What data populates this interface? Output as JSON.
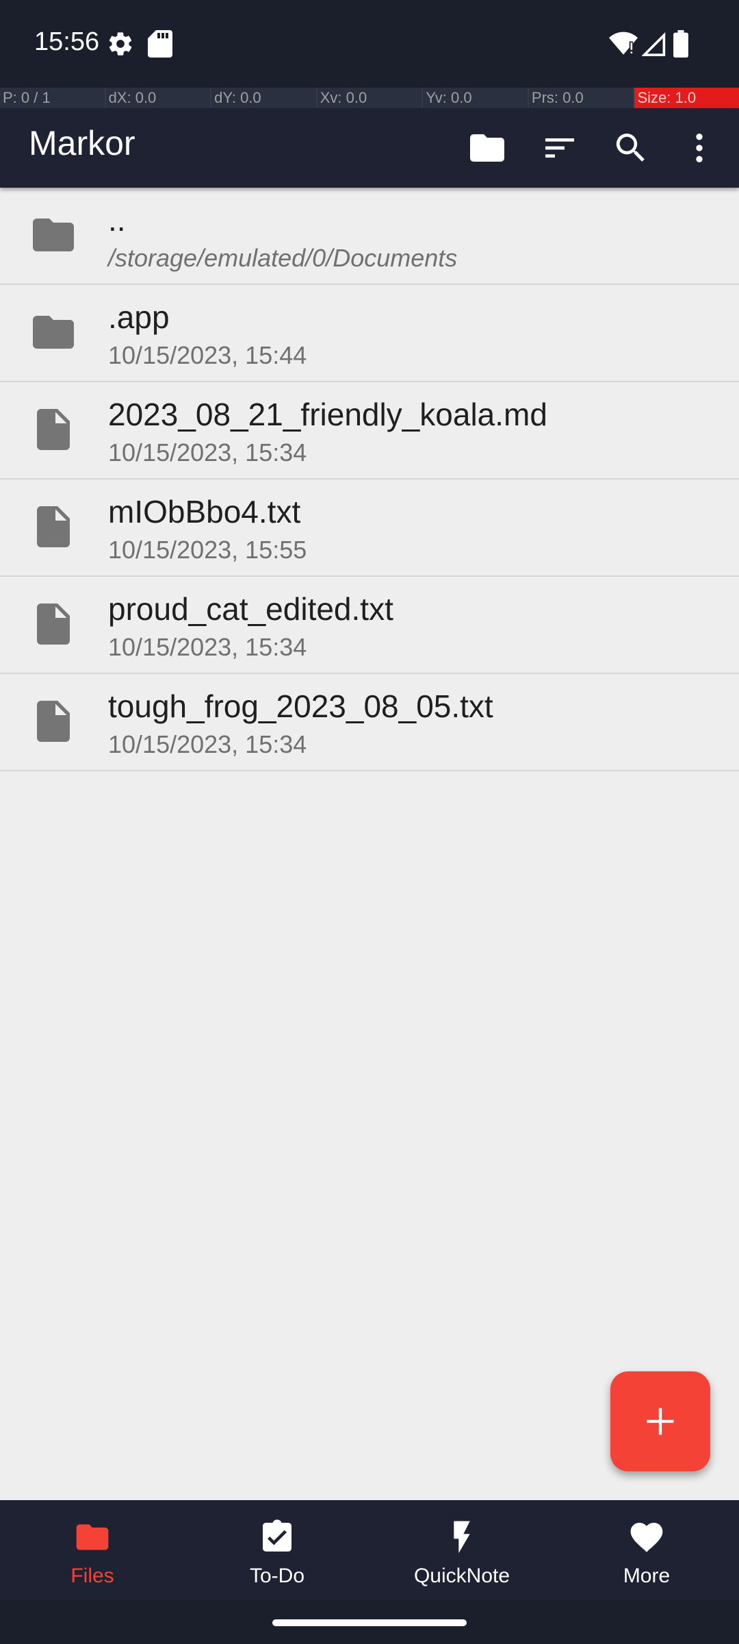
{
  "status_bar": {
    "time": "15:56",
    "icons": [
      "settings-icon",
      "sd-card-icon",
      "wifi-icon",
      "signal-icon",
      "battery-icon"
    ]
  },
  "debug_overlay": [
    "P: 0 / 1",
    "dX: 0.0",
    "dY: 0.0",
    "Xv: 0.0",
    "Yv: 0.0",
    "Prs: 0.0",
    "Size: 1.0"
  ],
  "app_bar": {
    "title": "Markor",
    "actions": [
      "folder-icon",
      "sort-icon",
      "search-icon",
      "more-vert-icon"
    ]
  },
  "files": [
    {
      "name": "..",
      "subtitle": "/storage/emulated/0/Documents",
      "type": "folder"
    },
    {
      "name": ".app",
      "subtitle": "10/15/2023, 15:44",
      "type": "folder"
    },
    {
      "name": "2023_08_21_friendly_koala.md",
      "subtitle": "10/15/2023, 15:34",
      "type": "file"
    },
    {
      "name": "mIObBbo4.txt",
      "subtitle": "10/15/2023, 15:55",
      "type": "file"
    },
    {
      "name": "proud_cat_edited.txt",
      "subtitle": "10/15/2023, 15:34",
      "type": "file"
    },
    {
      "name": "tough_frog_2023_08_05.txt",
      "subtitle": "10/15/2023, 15:34",
      "type": "file"
    }
  ],
  "bottom_nav": [
    {
      "label": "Files",
      "icon": "folder-icon",
      "active": true
    },
    {
      "label": "To-Do",
      "icon": "todo-clipboard-icon",
      "active": false
    },
    {
      "label": "QuickNote",
      "icon": "lightning-icon",
      "active": false
    },
    {
      "label": "More",
      "icon": "heart-icon",
      "active": false
    }
  ],
  "colors": {
    "accent": "#f44336",
    "appbar": "#1e2232",
    "background": "#eeeeee"
  }
}
